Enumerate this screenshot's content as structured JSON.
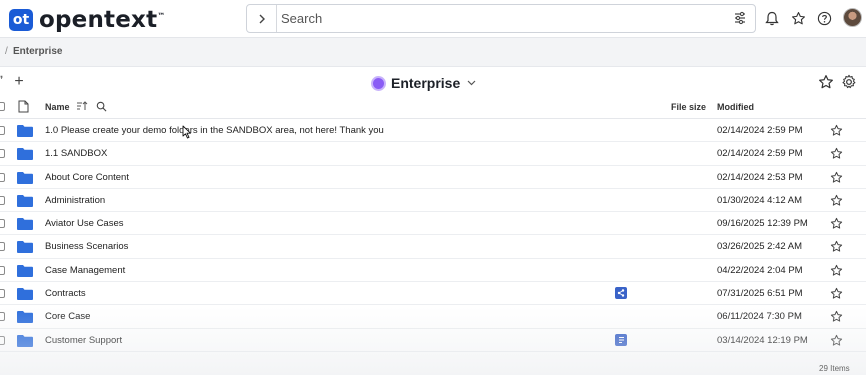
{
  "header": {
    "logo_mark": "ot",
    "brand": "opentext",
    "brand_tm": "™",
    "search_placeholder": "Search",
    "icons": [
      "chevron-right-icon",
      "filter-icon",
      "bell-icon",
      "star-icon",
      "help-icon",
      "avatar"
    ]
  },
  "breadcrumb": {
    "separator": "/",
    "current": "Enterprise"
  },
  "panel": {
    "title": "Enterprise",
    "add_label": "+",
    "left_edge_glyph": "❜"
  },
  "table": {
    "columns": {
      "name": "Name",
      "file_size": "File size",
      "modified": "Modified"
    },
    "rows": [
      {
        "name": "1.0 Please create your demo folders in the SANDBOX area, not here! Thank you",
        "modified": "02/14/2024 2:59 PM",
        "badge": ""
      },
      {
        "name": "1.1 SANDBOX",
        "modified": "02/14/2024 2:59 PM",
        "badge": ""
      },
      {
        "name": "About Core Content",
        "modified": "02/14/2024 2:53 PM",
        "badge": ""
      },
      {
        "name": "Administration",
        "modified": "01/30/2024 4:12 AM",
        "badge": ""
      },
      {
        "name": "Aviator Use Cases",
        "modified": "09/16/2025 12:39 PM",
        "badge": ""
      },
      {
        "name": "Business Scenarios",
        "modified": "03/26/2025 2:42 AM",
        "badge": ""
      },
      {
        "name": "Case Management",
        "modified": "04/22/2024 2:04 PM",
        "badge": ""
      },
      {
        "name": "Contracts",
        "modified": "07/31/2025 6:51 PM",
        "badge": "share-icon"
      },
      {
        "name": "Core Case",
        "modified": "06/11/2024 7:30 PM",
        "badge": ""
      },
      {
        "name": "Customer Support",
        "modified": "03/14/2024 12:19 PM",
        "badge": "document-icon"
      }
    ],
    "item_count": "29 Items"
  },
  "colors": {
    "brand": "#1a5bd6",
    "folder": "#2f6fdc",
    "badge": "#3a63c8",
    "globe": "#8a5cf5"
  }
}
